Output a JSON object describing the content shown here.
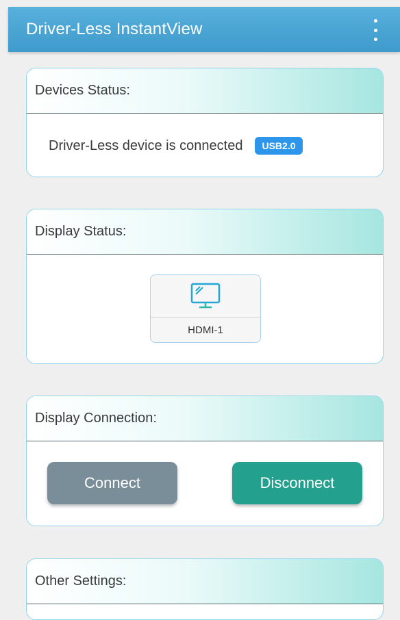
{
  "app_bar": {
    "title": "Driver-Less InstantView",
    "menu_icon": "more-vert-icon"
  },
  "devices_status": {
    "header": "Devices Status:",
    "message": "Driver-Less device is connected",
    "badge": "USB2.0"
  },
  "display_status": {
    "header": "Display Status:",
    "monitor_icon": "monitor-icon",
    "monitor_label": "HDMI-1"
  },
  "display_connection": {
    "header": "Display Connection:",
    "connect_label": "Connect",
    "disconnect_label": "Disconnect"
  },
  "other_settings": {
    "header": "Other Settings:"
  },
  "colors": {
    "app_bar": "#4aa6d5",
    "badge": "#2d95ea",
    "connect_button": "#7a8e99",
    "disconnect_button": "#24a08e",
    "card_header_accent": "#a6e6e0"
  }
}
